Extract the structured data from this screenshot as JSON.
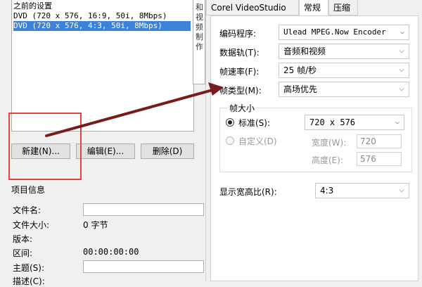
{
  "left": {
    "presets": {
      "heading": "之前的设置",
      "items": [
        {
          "label": "DVD (720 x 576, 16:9, 50i, 8Mbps)",
          "selected": false
        },
        {
          "label": "DVD (720 x 576, 4:3, 50i, 8Mbps)",
          "selected": true
        }
      ]
    },
    "buttons": {
      "new": "新建(N)...",
      "edit": "编辑(E)...",
      "delete": "删除(D)"
    },
    "project_info": {
      "title": "项目信息",
      "file_name_label": "文件名:",
      "file_size_label": "文件大小:",
      "file_size_value": "0 字节",
      "version_label": "版本:",
      "range_label": "区间:",
      "range_value": "00:00:00:00",
      "subject_label": "主题(S):",
      "desc_label": "描述(C):"
    }
  },
  "strip": {
    "text": "和 视 频 制 作"
  },
  "right": {
    "tabs": [
      "Corel VideoStudio",
      "常规",
      "压缩"
    ],
    "active_tab": 1,
    "encoder": {
      "label": "编码程序:",
      "value": "Ulead MPEG.Now Encoder"
    },
    "data_track": {
      "label": "数据轨(T):",
      "value": "音频和视频"
    },
    "frame_rate": {
      "label": "帧速率(F):",
      "value": "25 帧/秒"
    },
    "frame_type": {
      "label": "帧类型(M):",
      "value": "高场优先"
    },
    "frame_size": {
      "group_label": "帧大小",
      "standard_label": "标准(S):",
      "standard_value": "720 x 576",
      "custom_label": "自定义(D)",
      "width_label": "宽度(W):",
      "width_value": "720",
      "height_label": "高度(E):",
      "height_value": "576"
    },
    "aspect": {
      "label": "显示宽高比(R):",
      "value": "4:3"
    }
  },
  "colors": {
    "selection": "#3b82d9",
    "highlight_box": "#e0443f",
    "arrow": "#7a1b1b"
  }
}
